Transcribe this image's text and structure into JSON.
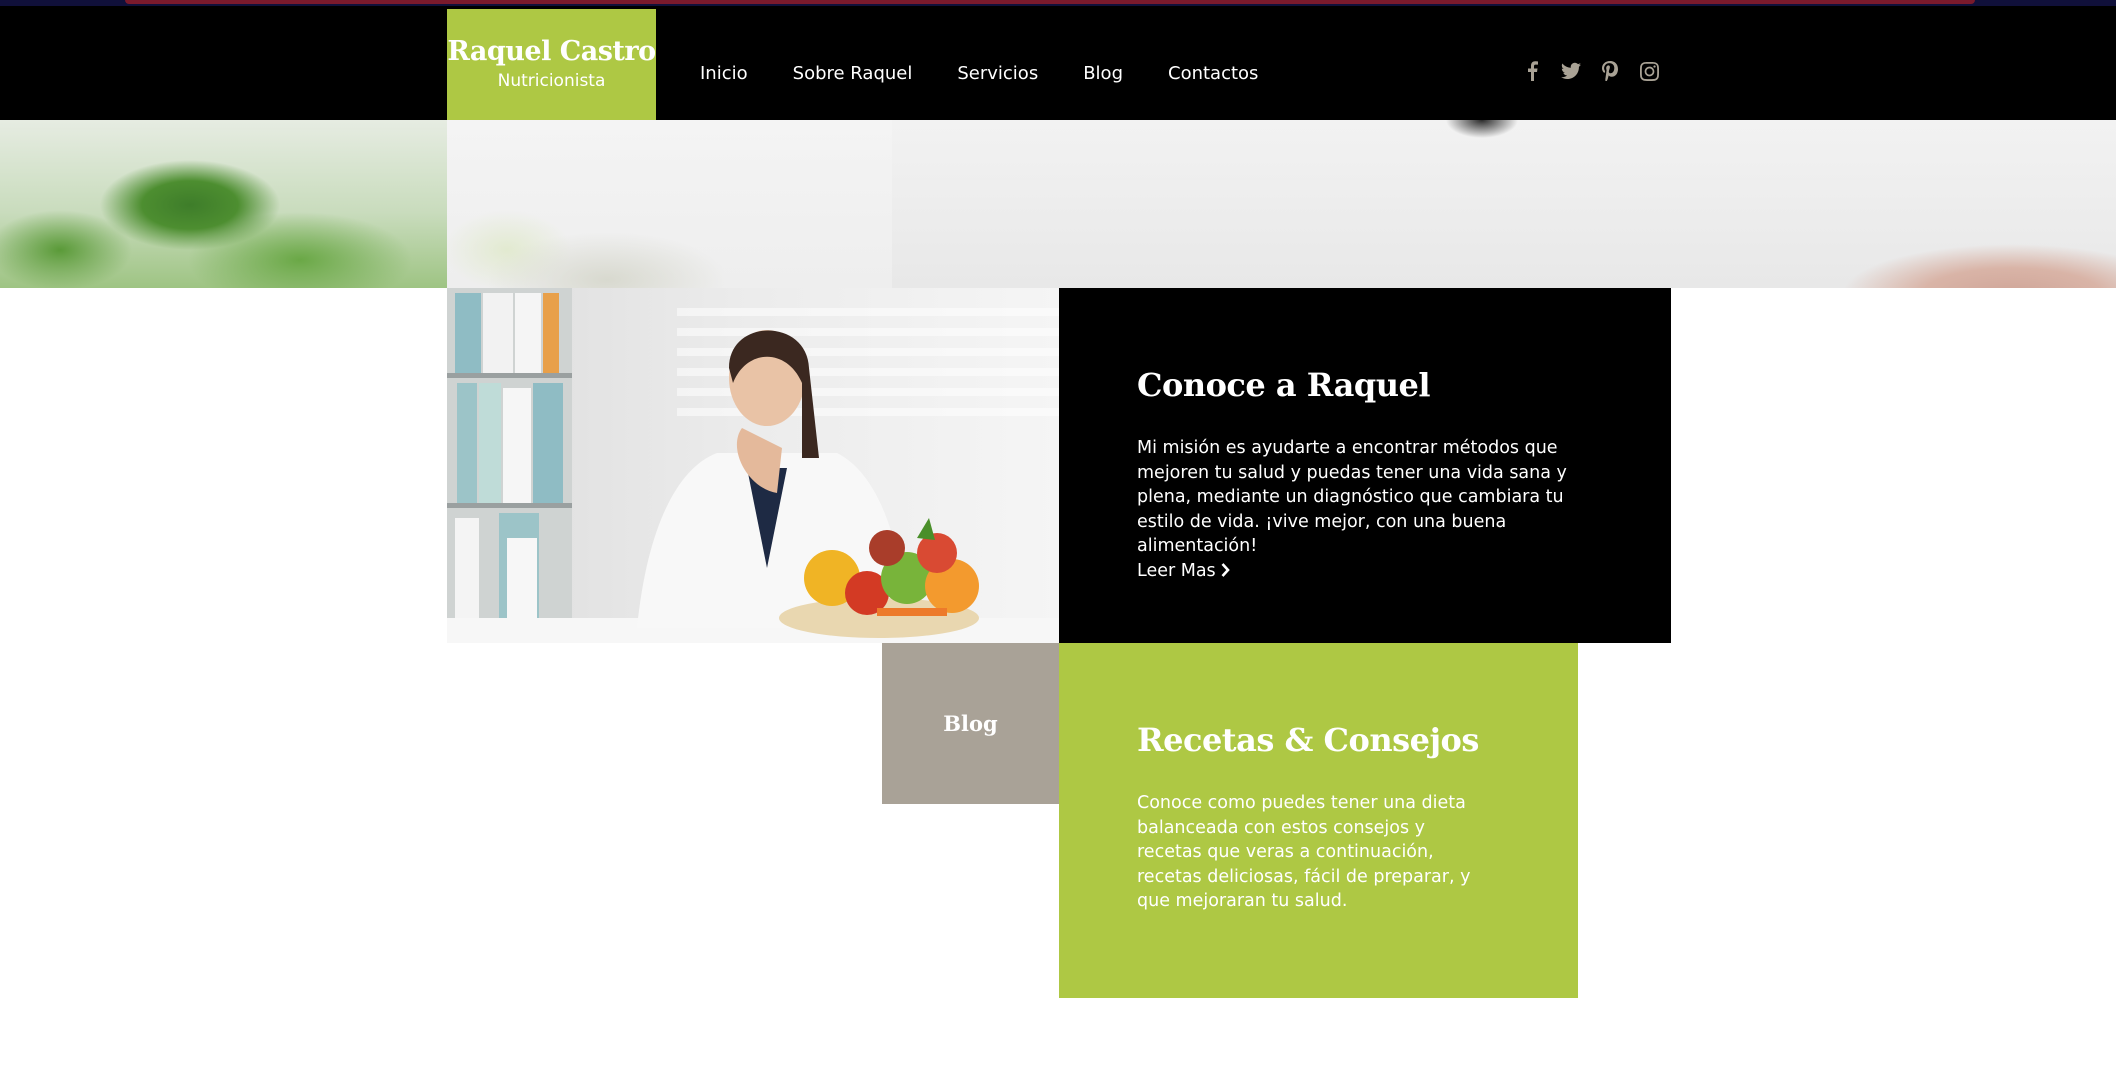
{
  "brand": {
    "name": "Raquel Castro",
    "subtitle": "Nutricionista",
    "accent_color": "#aec844",
    "header_bg": "#000000",
    "blog_tag_color": "#a9a297"
  },
  "nav": {
    "items": [
      {
        "label": "Inicio"
      },
      {
        "label": "Sobre Raquel"
      },
      {
        "label": "Servicios"
      },
      {
        "label": "Blog"
      },
      {
        "label": "Contactos"
      }
    ]
  },
  "social": {
    "icons": [
      "facebook-icon",
      "twitter-icon",
      "pinterest-icon",
      "instagram-icon"
    ]
  },
  "about": {
    "title": "Conoce a Raquel",
    "body": "Mi misión es ayudarte a encontrar métodos que mejoren tu salud y puedas tener una vida sana y plena, mediante un diagnóstico que cambiara tu estilo de vida. ¡vive mejor, con una buena alimentación!",
    "read_more": "Leer Mas",
    "read_more_icon": "chevron-right-icon"
  },
  "blog": {
    "tag": "Blog",
    "title": "Recetas & Consejos",
    "body": "Conoce como puedes tener una dieta balanceada con estos consejos y recetas que veras a continuación, recetas deliciosas, fácil de preparar, y que mejoraran tu salud."
  }
}
